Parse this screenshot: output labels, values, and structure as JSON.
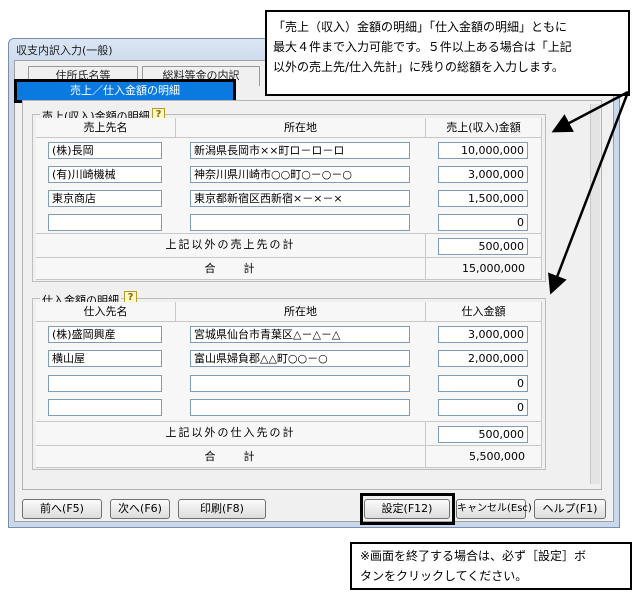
{
  "window": {
    "title": "収支内訳入力(一般)"
  },
  "tabs": [
    {
      "label": "住所氏名等"
    },
    {
      "label": "総料等金の内訳"
    },
    {
      "label": "売上／仕入金額の明細"
    }
  ],
  "sales": {
    "group_label": "売上(収入)金額の明細",
    "headers": {
      "name": "売上先名",
      "address": "所在地",
      "amount": "売上(収入)金額"
    },
    "rows": [
      {
        "name": "(株)長岡",
        "address": "新潟県長岡市××町ロ－ロ－ロ",
        "amount": "10,000,000"
      },
      {
        "name": "(有)川崎機械",
        "address": "神奈川県川崎市○○町○－○－○",
        "amount": "3,000,000"
      },
      {
        "name": "東京商店",
        "address": "東京都新宿区西新宿×－×－×",
        "amount": "1,500,000"
      },
      {
        "name": "",
        "address": "",
        "amount": "0"
      }
    ],
    "other_label": "上記以外の売上先の計",
    "other_value": "500,000",
    "total_label": "合　　計",
    "total_value": "15,000,000"
  },
  "purchases": {
    "group_label": "仕入金額の明細",
    "headers": {
      "name": "仕入先名",
      "address": "所在地",
      "amount": "仕入金額"
    },
    "rows": [
      {
        "name": "(株)盛岡興産",
        "address": "宮城県仙台市青葉区△－△－△",
        "amount": "3,000,000"
      },
      {
        "name": "横山屋",
        "address": "富山県婦負郡△△町○○－○",
        "amount": "2,000,000"
      },
      {
        "name": "",
        "address": "",
        "amount": "0"
      },
      {
        "name": "",
        "address": "",
        "amount": "0"
      }
    ],
    "other_label": "上記以外の仕入先の計",
    "other_value": "500,000",
    "total_label": "合　　計",
    "total_value": "5,500,000"
  },
  "buttons": {
    "prev": "前へ(F5)",
    "next": "次へ(F6)",
    "print": "印刷(F8)",
    "ok": "設定(F12)",
    "cancel": "キャンセル(Esc)",
    "help": "ヘルプ(F1)"
  },
  "callouts": {
    "top": [
      "「売上（収入）金額の明細」「仕入金額の明細」ともに",
      "最大４件まで入力可能です。５件以上ある場合は「上記",
      "以外の売上先/仕入先計」に残りの総額を入力します。"
    ],
    "bottom": [
      "※画面を終了する場合は、必ず［設定］ボ",
      "タンをクリックしてください。"
    ]
  }
}
